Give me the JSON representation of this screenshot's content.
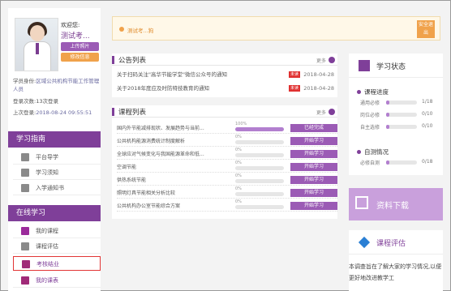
{
  "profile": {
    "welcome": "欢迎您:",
    "username": "测试考...",
    "upload_label": "上传照片",
    "edit_label": "修改信息",
    "identity_label": "学员身份:",
    "identity_value": "区域公共机构节能工作管理人员",
    "login_count_label": "登录次数:",
    "login_count_value": "13次登录",
    "last_login_label": "上次登录:",
    "last_login_value": "2018-08-24 09:55:51"
  },
  "study_guide": {
    "title": "学习指南",
    "items": [
      "平台导学",
      "学习须知",
      "入学通知书"
    ]
  },
  "online_study": {
    "title": "在线学习",
    "items": [
      "我的课程",
      "课程评估",
      "考核结业",
      "我的课表"
    ]
  },
  "notice": {
    "text": "测试考...狗",
    "logout_label": "安全退出"
  },
  "announcements": {
    "title": "公告列表",
    "more": "更多",
    "items": [
      {
        "title": "关于扫码关注\"高华节能学堂\"微信公众号的通知",
        "badge": "未读",
        "date": "2018-04-28"
      },
      {
        "title": "关于2018年度应及时防特技教育的通知",
        "badge": "未读",
        "date": "2018-04-28"
      }
    ]
  },
  "courses": {
    "title": "课程列表",
    "more": "更多",
    "items": [
      {
        "name": "国内外节能减排现状、发展趋势与当前...",
        "progress": 100,
        "pct_label": "100%",
        "action": "已经完成"
      },
      {
        "name": "公共机构能源消费统计制度解析",
        "progress": 0,
        "pct_label": "0%",
        "action": "开始学习"
      },
      {
        "name": "全球应对气候变化与我国能源革命和低...",
        "progress": 0,
        "pct_label": "0%",
        "action": "开始学习"
      },
      {
        "name": "空调节能",
        "progress": 0,
        "pct_label": "0%",
        "action": "开始学习"
      },
      {
        "name": "供热系统节能",
        "progress": 0,
        "pct_label": "0%",
        "action": "开始学习"
      },
      {
        "name": "照明灯具节能相关分析比较",
        "progress": 0,
        "pct_label": "0%",
        "action": "开始学习"
      },
      {
        "name": "公共机构办公室节能综合方案",
        "progress": 0,
        "pct_label": "0%",
        "action": "开始学习"
      }
    ]
  },
  "study_status": {
    "title": "学习状态",
    "progress_title": "课程进度",
    "progress_rows": [
      {
        "label": "通用必修",
        "value": "1/18",
        "fraction": 0.056
      },
      {
        "label": "岗位必修",
        "value": "0/10",
        "fraction": 0
      },
      {
        "label": "自主选修",
        "value": "0/10",
        "fraction": 0
      }
    ],
    "self_test_title": "自测情况",
    "self_test_rows": [
      {
        "label": "必修自测",
        "value": "0/18",
        "fraction": 0
      }
    ]
  },
  "download": {
    "title": "资料下载"
  },
  "evaluation": {
    "title": "课程评估",
    "text": "本调查旨在了解大家的学习情况,以便更好地改进教学工"
  }
}
